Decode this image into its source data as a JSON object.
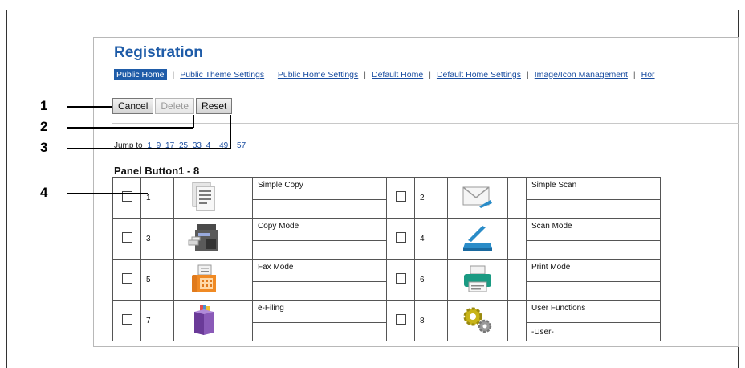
{
  "page": {
    "title": "Registration",
    "tabs": [
      "Public Home",
      "Public Theme Settings",
      "Public Home Settings",
      "Default Home",
      "Default Home Settings",
      "Image/Icon Management",
      "Hor"
    ],
    "buttons": {
      "cancel": "Cancel",
      "delete": "Delete",
      "reset": "Reset"
    },
    "jump_label": "Jump to",
    "jump_links": [
      "1",
      "9",
      "17",
      "25",
      "33",
      "4",
      "49",
      "57"
    ],
    "panel_title": "Panel Button1 - 8",
    "rows": [
      {
        "left": {
          "num": "1",
          "name": "Simple Copy",
          "sub": "",
          "icon": "document-icon"
        },
        "right": {
          "num": "2",
          "name": "Simple Scan",
          "sub": "",
          "icon": "envelope-icon"
        }
      },
      {
        "left": {
          "num": "3",
          "name": "Copy Mode",
          "sub": "",
          "icon": "copier-icon"
        },
        "right": {
          "num": "4",
          "name": "Scan Mode",
          "sub": "",
          "icon": "scanner-icon"
        }
      },
      {
        "left": {
          "num": "5",
          "name": "Fax Mode",
          "sub": "",
          "icon": "fax-icon"
        },
        "right": {
          "num": "6",
          "name": "Print Mode",
          "sub": "",
          "icon": "printer-icon"
        }
      },
      {
        "left": {
          "num": "7",
          "name": "e-Filing",
          "sub": "",
          "icon": "efiling-box-icon"
        },
        "right": {
          "num": "8",
          "name": "User Functions",
          "sub": "-User-",
          "icon": "gears-icon"
        }
      }
    ]
  },
  "callouts": [
    "1",
    "2",
    "3",
    "4"
  ],
  "colors": {
    "brand_blue": "#1f5ca8",
    "link": "#1a4da0"
  }
}
